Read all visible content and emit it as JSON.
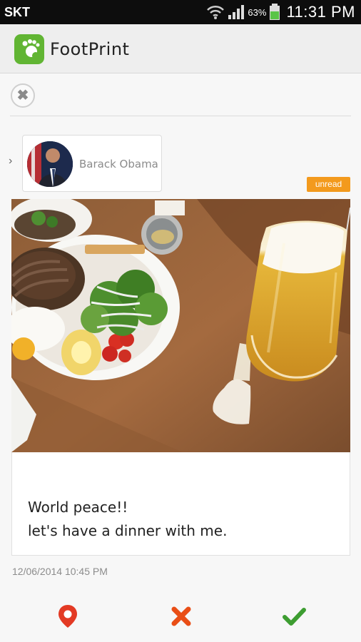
{
  "status_bar": {
    "carrier": "SKT",
    "battery": "63%",
    "time": "11:31 PM"
  },
  "app": {
    "title": "FootPrint"
  },
  "sender": {
    "name": "Barack Obama"
  },
  "badge": {
    "label": "unread"
  },
  "message": {
    "line1": "World peace!!",
    "line2": "let's have a dinner with me."
  },
  "timestamp": "12/06/2014 10:45 PM",
  "actions": {
    "location_icon": "location-pin-icon",
    "reject_icon": "reject-x-icon",
    "accept_icon": "accept-check-icon"
  },
  "colors": {
    "brand_green": "#61b533",
    "badge_orange": "#f39a1d",
    "reject_orange": "#e94e16",
    "accept_green": "#3d9d31",
    "location_red": "#e33a24"
  }
}
